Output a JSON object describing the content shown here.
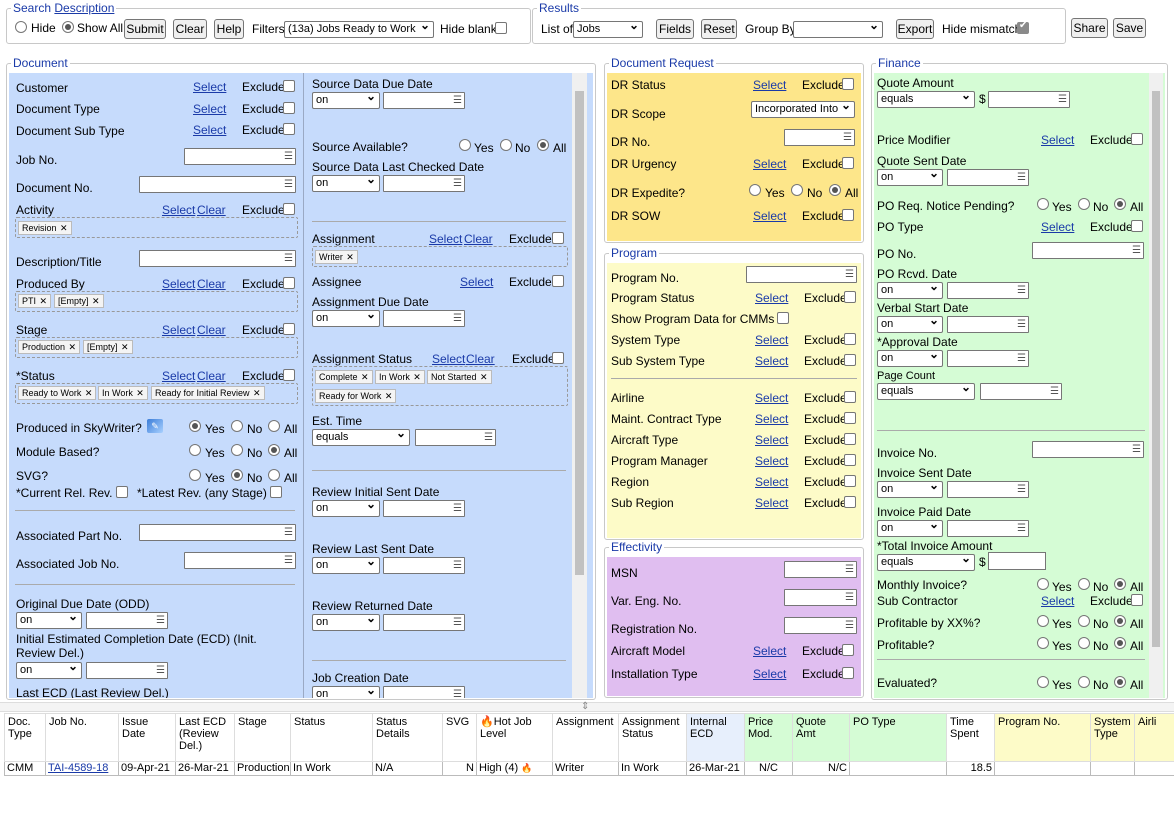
{
  "search": {
    "legend_a": "Search",
    "legend_b": "Description",
    "hide": "Hide",
    "show_all": "Show All",
    "submit": "Submit",
    "clear": "Clear",
    "help": "Help",
    "filters_label": "Filters",
    "filters_value": "(13a) Jobs Ready to Work",
    "hide_blank": "Hide blank"
  },
  "results": {
    "legend": "Results",
    "list_of": "List of",
    "list_value": "Jobs",
    "fields": "Fields",
    "reset": "Reset",
    "group_by": "Group By",
    "group_value": "",
    "export": "Export",
    "hide_mismatch": "Hide mismatch",
    "share": "Share",
    "save": "Save"
  },
  "common": {
    "select": "Select",
    "clear": "Clear",
    "exclude": "Exclude",
    "on": "on",
    "equals": "equals",
    "yes": "Yes",
    "no": "No",
    "all": "All",
    "dollar": "$"
  },
  "document": {
    "legend": "Document",
    "customer": "Customer",
    "document_type": "Document Type",
    "document_sub_type": "Document Sub Type",
    "job_no": "Job No.",
    "document_no": "Document No.",
    "activity": "Activity",
    "activity_tags": [
      "Revision"
    ],
    "description_title": "Description/Title",
    "produced_by": "Produced By",
    "produced_by_tags": [
      "PTI",
      "[Empty]"
    ],
    "stage": "Stage",
    "stage_tags": [
      "Production",
      "[Empty]"
    ],
    "status": "*Status",
    "status_tags": [
      "Ready to Work",
      "In Work",
      "Ready for Initial Review"
    ],
    "produced_in_skywriter": "Produced in SkyWriter?",
    "module_based": "Module Based?",
    "svg": "SVG?",
    "current_rel_rev": "*Current Rel. Rev.",
    "latest_rev": "*Latest Rev. (any Stage)",
    "associated_part_no": "Associated Part No.",
    "associated_job_no": "Associated Job No.",
    "original_due_date": "Original Due Date (ODD)",
    "initial_ecd_1": "Initial Estimated Completion Date (ECD) (Init.",
    "initial_ecd_2": "Review Del.)",
    "last_ecd": "Last ECD (Last Review Del.)",
    "source_data_due_date": "Source Data Due Date",
    "source_available": "Source Available?",
    "source_last_checked": "Source Data Last Checked Date",
    "assignment": "Assignment",
    "assignment_tags": [
      "Writer"
    ],
    "assignee": "Assignee",
    "assignment_due_date": "Assignment Due Date",
    "assignment_status": "Assignment Status",
    "assignment_status_tags": [
      "Complete",
      "In Work",
      "Not Started",
      "Ready for Work"
    ],
    "est_time": "Est. Time",
    "review_initial_sent": "Review Initial Sent Date",
    "review_last_sent": "Review Last Sent Date",
    "review_returned": "Review Returned Date",
    "job_creation_date": "Job Creation Date"
  },
  "doc_request": {
    "legend": "Document Request",
    "dr_status": "DR Status",
    "dr_scope": "DR Scope",
    "dr_scope_value": "Incorporated Into",
    "dr_no": "DR No.",
    "dr_urgency": "DR Urgency",
    "dr_expedite": "DR Expedite?",
    "dr_sow": "DR SOW"
  },
  "program": {
    "legend": "Program",
    "program_no": "Program No.",
    "program_status": "Program Status",
    "show_program_data": "Show Program Data for CMMs",
    "system_type": "System Type",
    "sub_system_type": "Sub System Type",
    "airline": "Airline",
    "maint_contract_type": "Maint. Contract Type",
    "aircraft_type": "Aircraft Type",
    "program_manager": "Program Manager",
    "region": "Region",
    "sub_region": "Sub Region"
  },
  "effectivity": {
    "legend": "Effectivity",
    "msn": "MSN",
    "var_eng_no": "Var. Eng. No.",
    "registration_no": "Registration No.",
    "aircraft_model": "Aircraft Model",
    "installation_type": "Installation Type"
  },
  "finance": {
    "legend": "Finance",
    "quote_amount": "Quote Amount",
    "price_modifier": "Price Modifier",
    "quote_sent_date": "Quote Sent Date",
    "po_req_notice": "PO Req. Notice Pending?",
    "po_type": "PO Type",
    "po_no": "PO No.",
    "po_rcvd_date": "PO Rcvd. Date",
    "verbal_start_date": "Verbal Start Date",
    "approval_date": "*Approval Date",
    "page_count": "Page Count",
    "invoice_no": "Invoice No.",
    "invoice_sent_date": "Invoice Sent Date",
    "invoice_paid_date": "Invoice Paid Date",
    "total_invoice_amount": "*Total Invoice Amount",
    "monthly_invoice": "Monthly Invoice?",
    "sub_contractor": "Sub Contractor",
    "profitable_by": "Profitable by XX%?",
    "profitable": "Profitable?",
    "evaluated": "Evaluated?"
  },
  "grid": {
    "headers": [
      "Doc. Type",
      "Job No.",
      "Issue Date",
      "Last ECD (Review Del.)",
      "Stage",
      "Status",
      "Status Details",
      "SVG",
      "Hot Job Level",
      "Assignment",
      "Assignment Status",
      "Internal ECD",
      "Price Mod.",
      "Quote Amt",
      "PO Type",
      "Time Spent",
      "Program No.",
      "System Type",
      "Airli"
    ],
    "rows": [
      [
        "CMM",
        "TAI-4589-18",
        "09-Apr-21",
        "26-Mar-21",
        "Production",
        "In Work",
        "N/A",
        "N",
        "High (4)",
        "Writer",
        "In Work",
        "26-Mar-21",
        "N/C",
        "N/C",
        "",
        "18.5",
        "",
        "",
        ""
      ]
    ]
  },
  "colors": {
    "document_bg": "#c6dbfc",
    "doc_request_bg": "#fde68a",
    "program_bg": "#fdfbc8",
    "effectivity_bg": "#e0bef0",
    "finance_bg": "#d5fcd5",
    "link": "#1a3aa8"
  }
}
